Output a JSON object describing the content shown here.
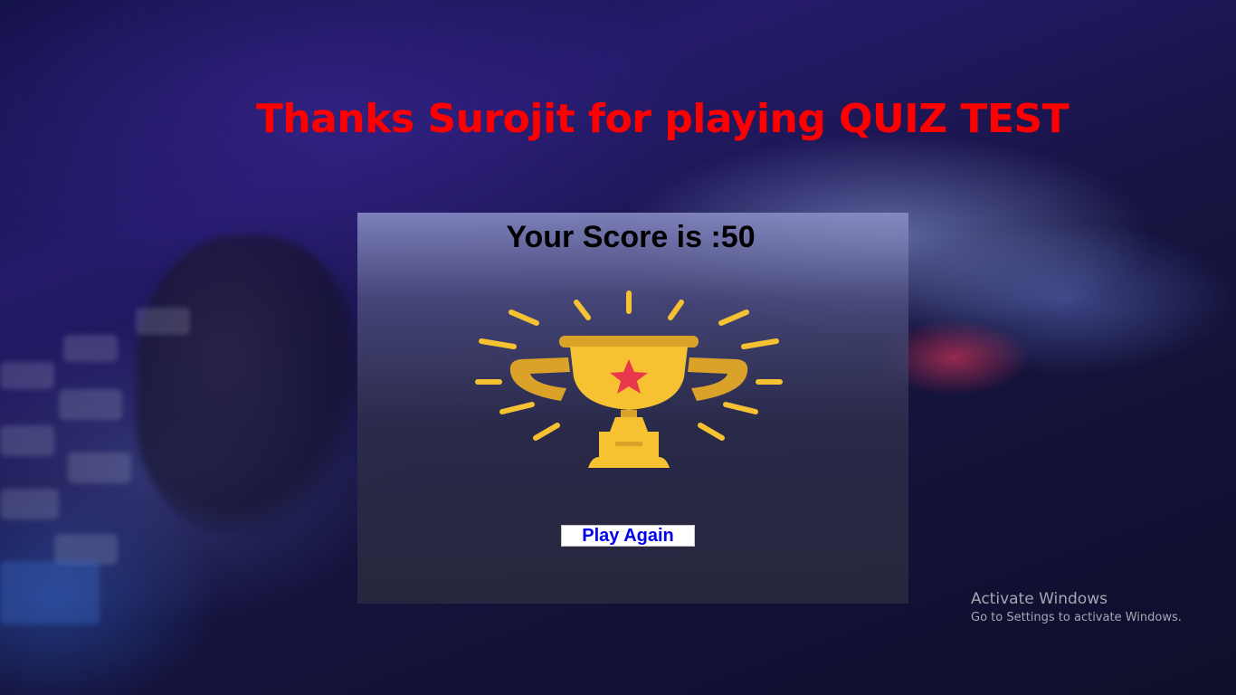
{
  "heading": {
    "text": "Thanks Surojit for playing QUIZ TEST",
    "color": "#ff0000"
  },
  "result_card": {
    "score_text": "Your Score is :50",
    "trophy_icon": "trophy-icon",
    "play_again_label": "Play Again",
    "button_text_color": "#0000ee"
  },
  "activation_watermark": {
    "title": "Activate Windows",
    "subtitle": "Go to Settings to activate Windows."
  },
  "colors": {
    "trophy_gold": "#f6c232",
    "trophy_shadow": "#dba22a",
    "star_red": "#e8394c"
  }
}
